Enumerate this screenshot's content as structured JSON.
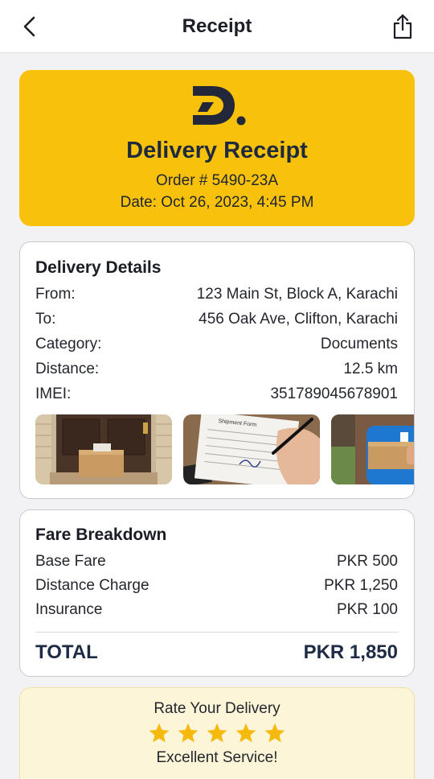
{
  "header": {
    "title": "Receipt",
    "back_icon": "chevron-left-icon",
    "share_icon": "share-icon"
  },
  "hero": {
    "logo_letter": "D",
    "title": "Delivery Receipt",
    "order": "Order # 5490-23A",
    "date": "Date: Oct 26, 2023, 4:45 PM",
    "background": "#f8c20c"
  },
  "delivery_details": {
    "title": "Delivery Details",
    "rows": [
      {
        "label": "From:",
        "value": "123 Main St, Block A, Karachi"
      },
      {
        "label": "To:",
        "value": "456 Oak Ave, Clifton, Karachi"
      },
      {
        "label": "Category:",
        "value": "Documents"
      },
      {
        "label": "Distance:",
        "value": "12.5 km"
      },
      {
        "label": "IMEI:",
        "value": "351789045678901"
      }
    ],
    "photos": [
      {
        "name": "package-at-door-photo"
      },
      {
        "name": "signing-form-photo",
        "paper_title": "Shipment Form"
      },
      {
        "name": "courier-handing-package-photo"
      }
    ]
  },
  "fare": {
    "title": "Fare Breakdown",
    "rows": [
      {
        "label": "Base Fare",
        "value": "PKR 500"
      },
      {
        "label": "Distance Charge",
        "value": "PKR 1,250"
      },
      {
        "label": "Insurance",
        "value": "PKR 100"
      }
    ],
    "total_label": "TOTAL",
    "total_value": "PKR 1,850"
  },
  "rating": {
    "title": "Rate Your Delivery",
    "stars": 5,
    "max_stars": 5,
    "caption": "Excellent Service!",
    "star_color": "#f6b90d"
  }
}
